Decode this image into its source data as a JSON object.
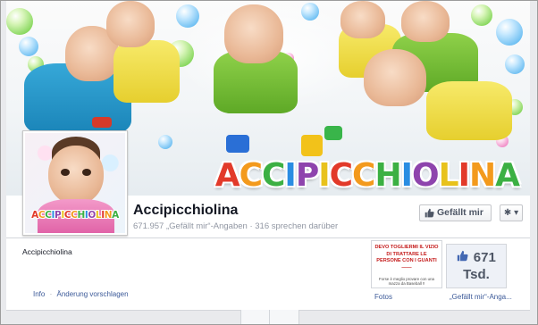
{
  "page": {
    "name": "Accipicchiolina",
    "likes_summary": "671.957 „Gefällt mir“-Angaben",
    "stats_separator": "·",
    "talking_about": "316 sprechen darüber"
  },
  "cover": {
    "logo_text": "ACCIPICCHIOLINA"
  },
  "profile_picture": {
    "logo_text": "ACCIPICCHIOLINA"
  },
  "actions": {
    "like_label": "Gefällt mir",
    "like_icon": "thumbs-up-icon",
    "gear_icon": "gear-icon",
    "gear_symbol": "✱ ▾"
  },
  "about": {
    "text": "Accipicchiolina"
  },
  "links": {
    "info": "Info",
    "separator": "·",
    "suggest_edit": "Änderung vorschlagen"
  },
  "apps": [
    {
      "caption": "Fotos",
      "thumb_headline": "DEVO TOGLIERMI IL VIZIO DI TRATTARE LE PERSONE CON I GUANTI ——",
      "thumb_sub": "Forse è meglio provare con una mazza da Baseball !!"
    },
    {
      "caption": "„Gefällt mir“-Anga...",
      "thumb_count": "671",
      "thumb_unit": "Tsd.",
      "thumb_icon": "thumbs-up-icon"
    }
  ],
  "colors": {
    "link": "#3b5998",
    "muted": "#9197a3",
    "background": "#e9eaed"
  }
}
